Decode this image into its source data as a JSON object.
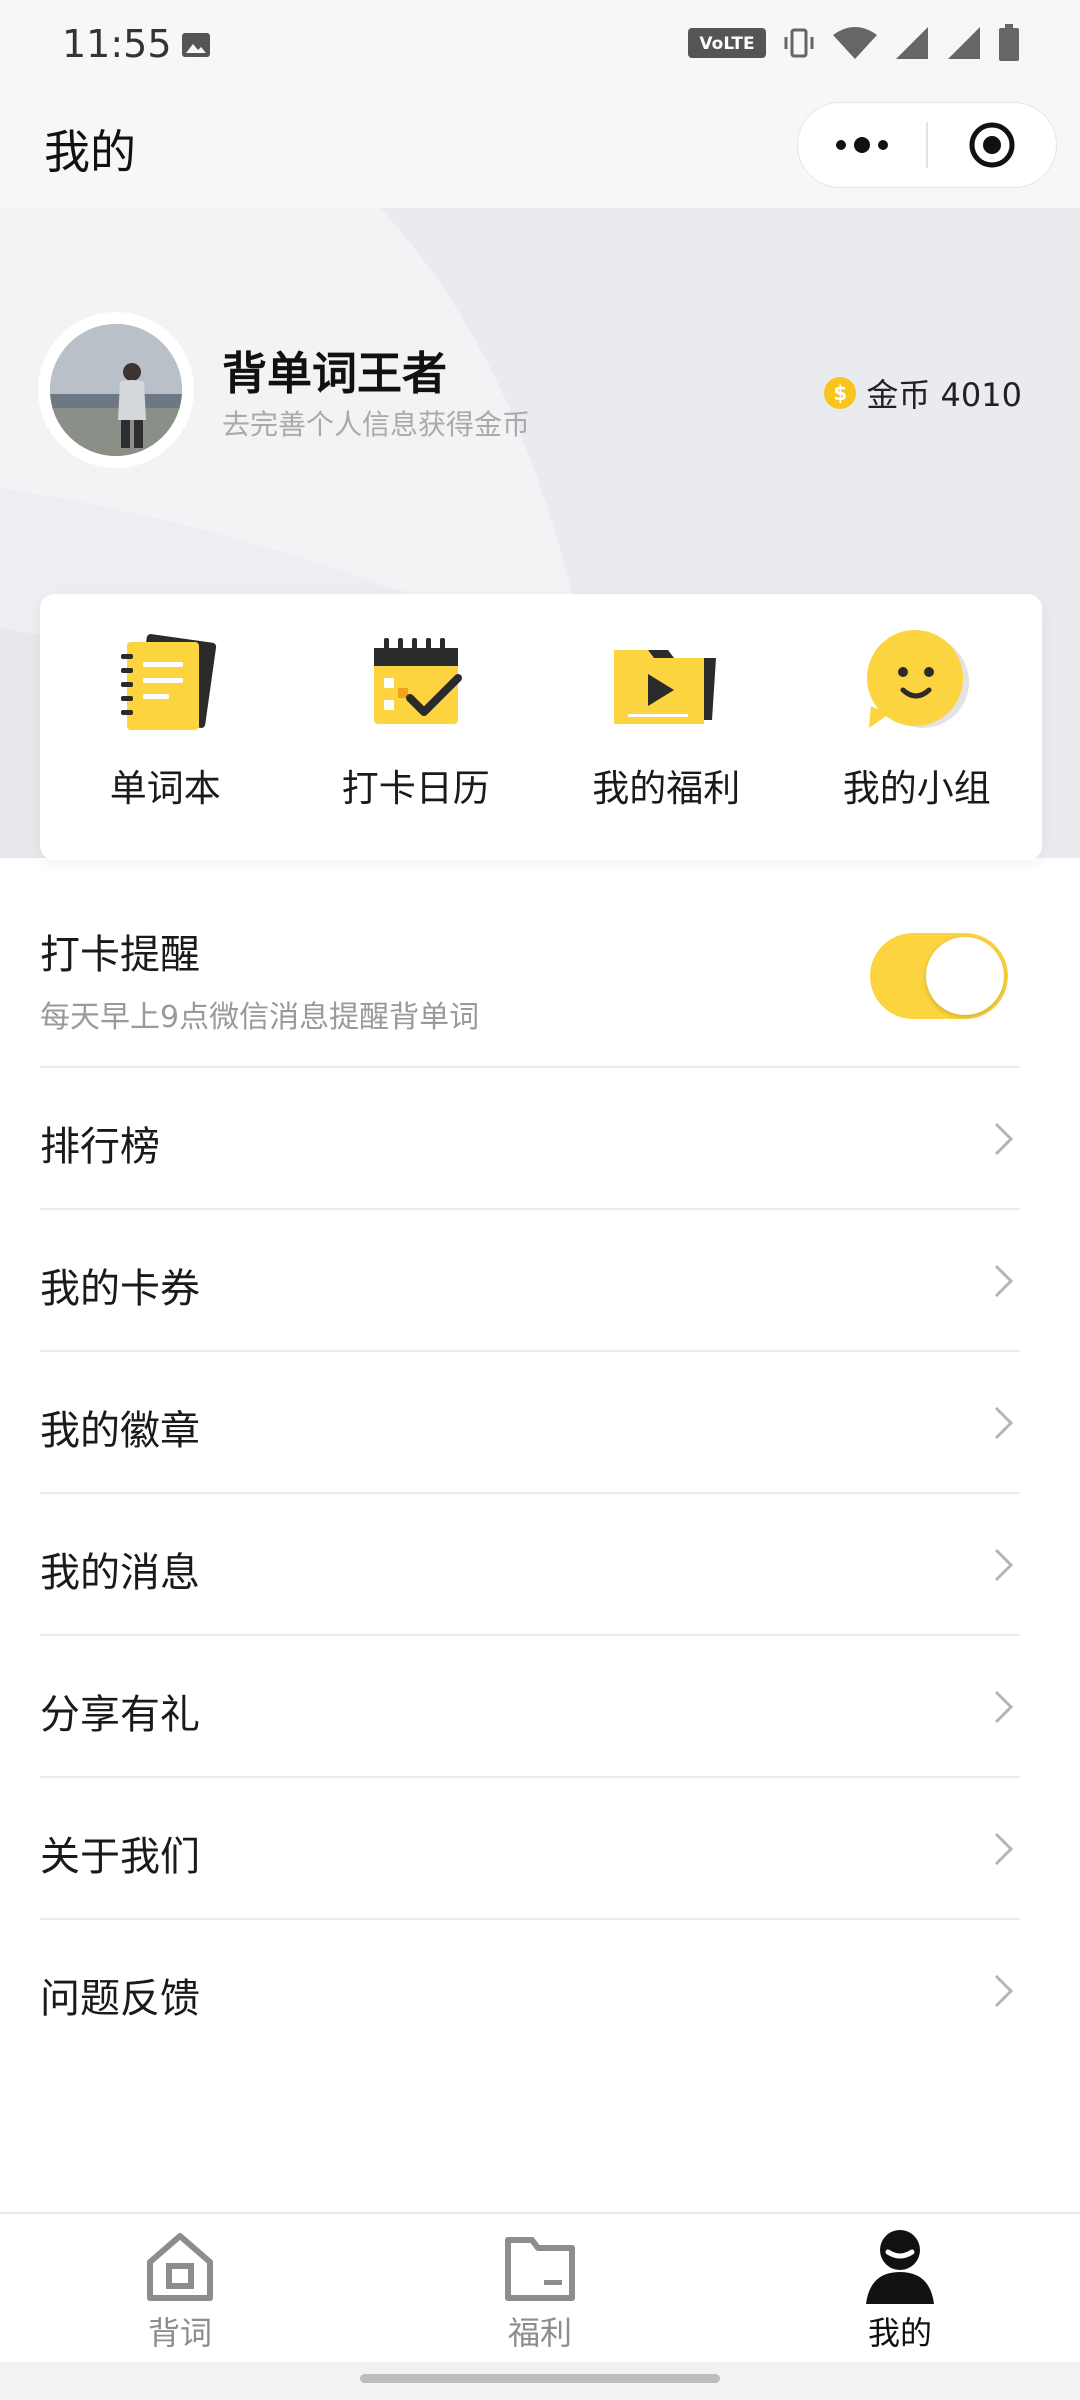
{
  "status_bar": {
    "time": "11:55",
    "volte": "VoLTE"
  },
  "nav": {
    "title": "我的"
  },
  "profile": {
    "name": "背单词王者",
    "subtitle": "去完善个人信息获得金币",
    "coins_label": "金币 4010"
  },
  "quick_actions": [
    {
      "label": "单词本",
      "icon": "notebook-icon"
    },
    {
      "label": "打卡日历",
      "icon": "calendar-check-icon"
    },
    {
      "label": "我的福利",
      "icon": "play-folder-icon"
    },
    {
      "label": "我的小组",
      "icon": "smiley-chat-icon"
    }
  ],
  "reminder": {
    "title": "打卡提醒",
    "subtitle": "每天早上9点微信消息提醒背单词",
    "enabled": true
  },
  "menu": [
    {
      "label": "排行榜"
    },
    {
      "label": "我的卡券"
    },
    {
      "label": "我的徽章"
    },
    {
      "label": "我的消息"
    },
    {
      "label": "分享有礼"
    },
    {
      "label": "关于我们"
    },
    {
      "label": "问题反馈"
    }
  ],
  "tabs": [
    {
      "label": "背词",
      "icon": "home-icon",
      "active": false
    },
    {
      "label": "福利",
      "icon": "folder-icon",
      "active": false
    },
    {
      "label": "我的",
      "icon": "person-icon",
      "active": true
    }
  ],
  "colors": {
    "accent": "#fcd440",
    "coin": "#f8c51c",
    "background": "#f2f3f5"
  }
}
